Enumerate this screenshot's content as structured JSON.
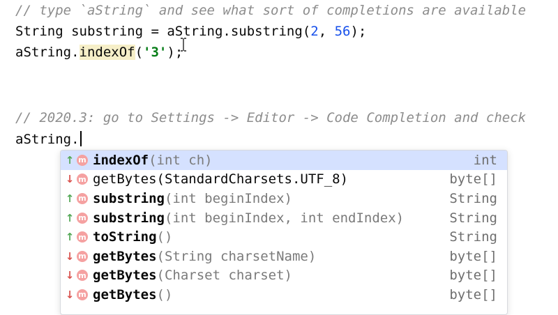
{
  "editor": {
    "line1": "// type `aString` and see what sort of completions are available",
    "line2": {
      "a": "String substring = aString.substring(",
      "n1": "2",
      "b": ", ",
      "n2": "56",
      "c": ");"
    },
    "line3": {
      "obj": "aString.",
      "method": "indexOf",
      "open": "(",
      "arg": "'3'",
      "close": ");"
    },
    "line4": "// 2020.3: go to Settings -> Editor -> Code Completion and check",
    "line5": "aString."
  },
  "completion": {
    "items": [
      {
        "arrow": "↑",
        "badge": "m",
        "name": "indexOf",
        "params": "(int ch)",
        "type": "int"
      },
      {
        "arrow": "↓",
        "badge": "m",
        "name": "getBytes",
        "params": "(StandardCharsets.UTF_8)",
        "type": "byte[]"
      },
      {
        "arrow": "↑",
        "badge": "m",
        "name": "substring",
        "params": "(int beginIndex)",
        "type": "String"
      },
      {
        "arrow": "↑",
        "badge": "m",
        "name": "substring",
        "params": "(int beginIndex, int endIndex)",
        "type": "String"
      },
      {
        "arrow": "↑",
        "badge": "m",
        "name": "toString",
        "params": "()",
        "type": "String"
      },
      {
        "arrow": "↓",
        "badge": "m",
        "name": "getBytes",
        "params": "(String charsetName)",
        "type": "byte[]"
      },
      {
        "arrow": "↓",
        "badge": "m",
        "name": "getBytes",
        "params": "(Charset charset)",
        "type": "byte[]"
      },
      {
        "arrow": "↓",
        "badge": "m",
        "name": "getBytes",
        "params": "()",
        "type": "byte[]"
      }
    ]
  },
  "colors": {
    "comment": "#8c8c8c",
    "number": "#1750eb",
    "string": "#067d17",
    "selection": "#d5e1ff",
    "arrow_up": "#54a857",
    "arrow_down": "#d9534f",
    "method_badge": "#f5a1a1"
  }
}
